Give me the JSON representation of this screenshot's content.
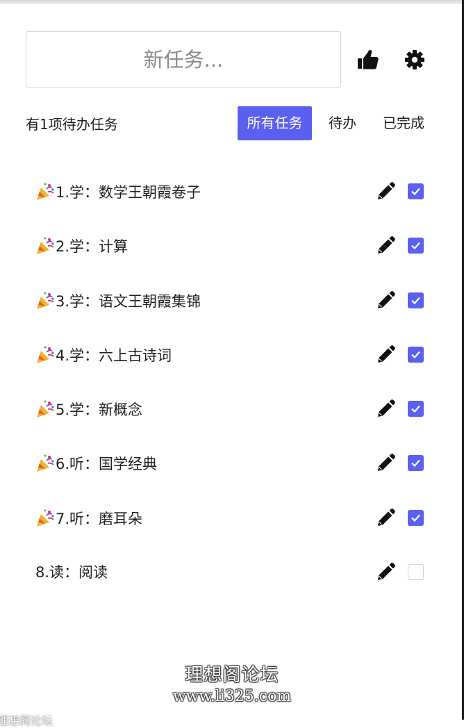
{
  "new_task": {
    "placeholder": "新任务..."
  },
  "header": {
    "like_icon": "thumbs-up-icon",
    "settings_icon": "gear-icon"
  },
  "status": {
    "pending_text": "有1项待办任务"
  },
  "filters": {
    "all": "所有任务",
    "todo": "待办",
    "done": "已完成",
    "active": "all"
  },
  "accent_color": "#5c60f0",
  "tasks": [
    {
      "label": "1.学：数学王朝霞卷子",
      "completed": true,
      "icon": "party-popper-icon"
    },
    {
      "label": "2.学：计算",
      "completed": true,
      "icon": "party-popper-icon"
    },
    {
      "label": "3.学：语文王朝霞集锦",
      "completed": true,
      "icon": "party-popper-icon"
    },
    {
      "label": "4.学：六上古诗词",
      "completed": true,
      "icon": "party-popper-icon"
    },
    {
      "label": "5.学：新概念",
      "completed": true,
      "icon": "party-popper-icon"
    },
    {
      "label": "6.听：国学经典",
      "completed": true,
      "icon": "party-popper-icon"
    },
    {
      "label": "7.听：磨耳朵",
      "completed": true,
      "icon": "party-popper-icon"
    },
    {
      "label": "8.读：阅读",
      "completed": false
    }
  ],
  "watermark": {
    "name": "理想阁论坛",
    "url": "www.li325.com",
    "corner": "理想阁论坛"
  }
}
